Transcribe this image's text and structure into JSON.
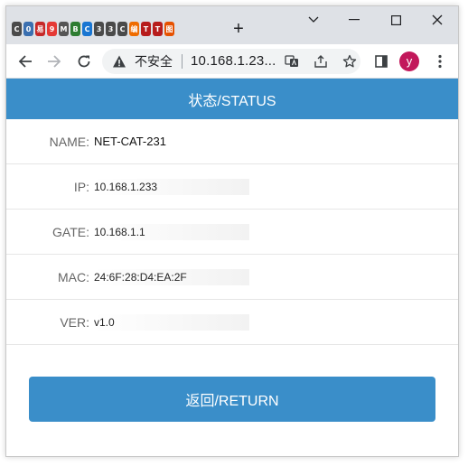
{
  "browser": {
    "favicons": [
      {
        "name": "favicon-1",
        "glyph": "C",
        "color": "#4a4a4a"
      },
      {
        "name": "favicon-2",
        "glyph": "0",
        "color": "#3a6fb0"
      },
      {
        "name": "favicon-3",
        "glyph": "易",
        "color": "#c62828"
      },
      {
        "name": "favicon-4",
        "glyph": "9",
        "color": "#e53935"
      },
      {
        "name": "favicon-5",
        "glyph": "M",
        "color": "#555555"
      },
      {
        "name": "favicon-6",
        "glyph": "B",
        "color": "#2e7d32"
      },
      {
        "name": "favicon-7",
        "glyph": "C",
        "color": "#1976d2"
      },
      {
        "name": "favicon-8",
        "glyph": "3",
        "color": "#4a4a4a"
      },
      {
        "name": "favicon-9",
        "glyph": "3",
        "color": "#4a4a4a"
      },
      {
        "name": "favicon-10",
        "glyph": "C",
        "color": "#4a4a4a"
      },
      {
        "name": "favicon-11",
        "glyph": "编",
        "color": "#ef6c00"
      },
      {
        "name": "favicon-12",
        "glyph": "T",
        "color": "#b71c1c"
      },
      {
        "name": "favicon-13",
        "glyph": "T",
        "color": "#b71c1c"
      },
      {
        "name": "favicon-14",
        "glyph": "图",
        "color": "#e65100"
      }
    ],
    "new_tab": "+",
    "insecure_label": "不安全",
    "url": "10.168.1.23...",
    "avatar_letter": "y"
  },
  "page": {
    "header": "状态/STATUS",
    "rows": [
      {
        "label": "NAME:",
        "value": "NET-CAT-231"
      },
      {
        "label": "IP:",
        "value": "10.168.1.233"
      },
      {
        "label": "GATE:",
        "value": "10.168.1.1"
      },
      {
        "label": "MAC:",
        "value": "24:6F:28:D4:EA:2F"
      },
      {
        "label": "VER:",
        "value": "v1.0"
      }
    ],
    "return_button": "返回/RETURN"
  },
  "colors": {
    "accent": "#3a8ec9",
    "avatar": "#c2185b"
  }
}
